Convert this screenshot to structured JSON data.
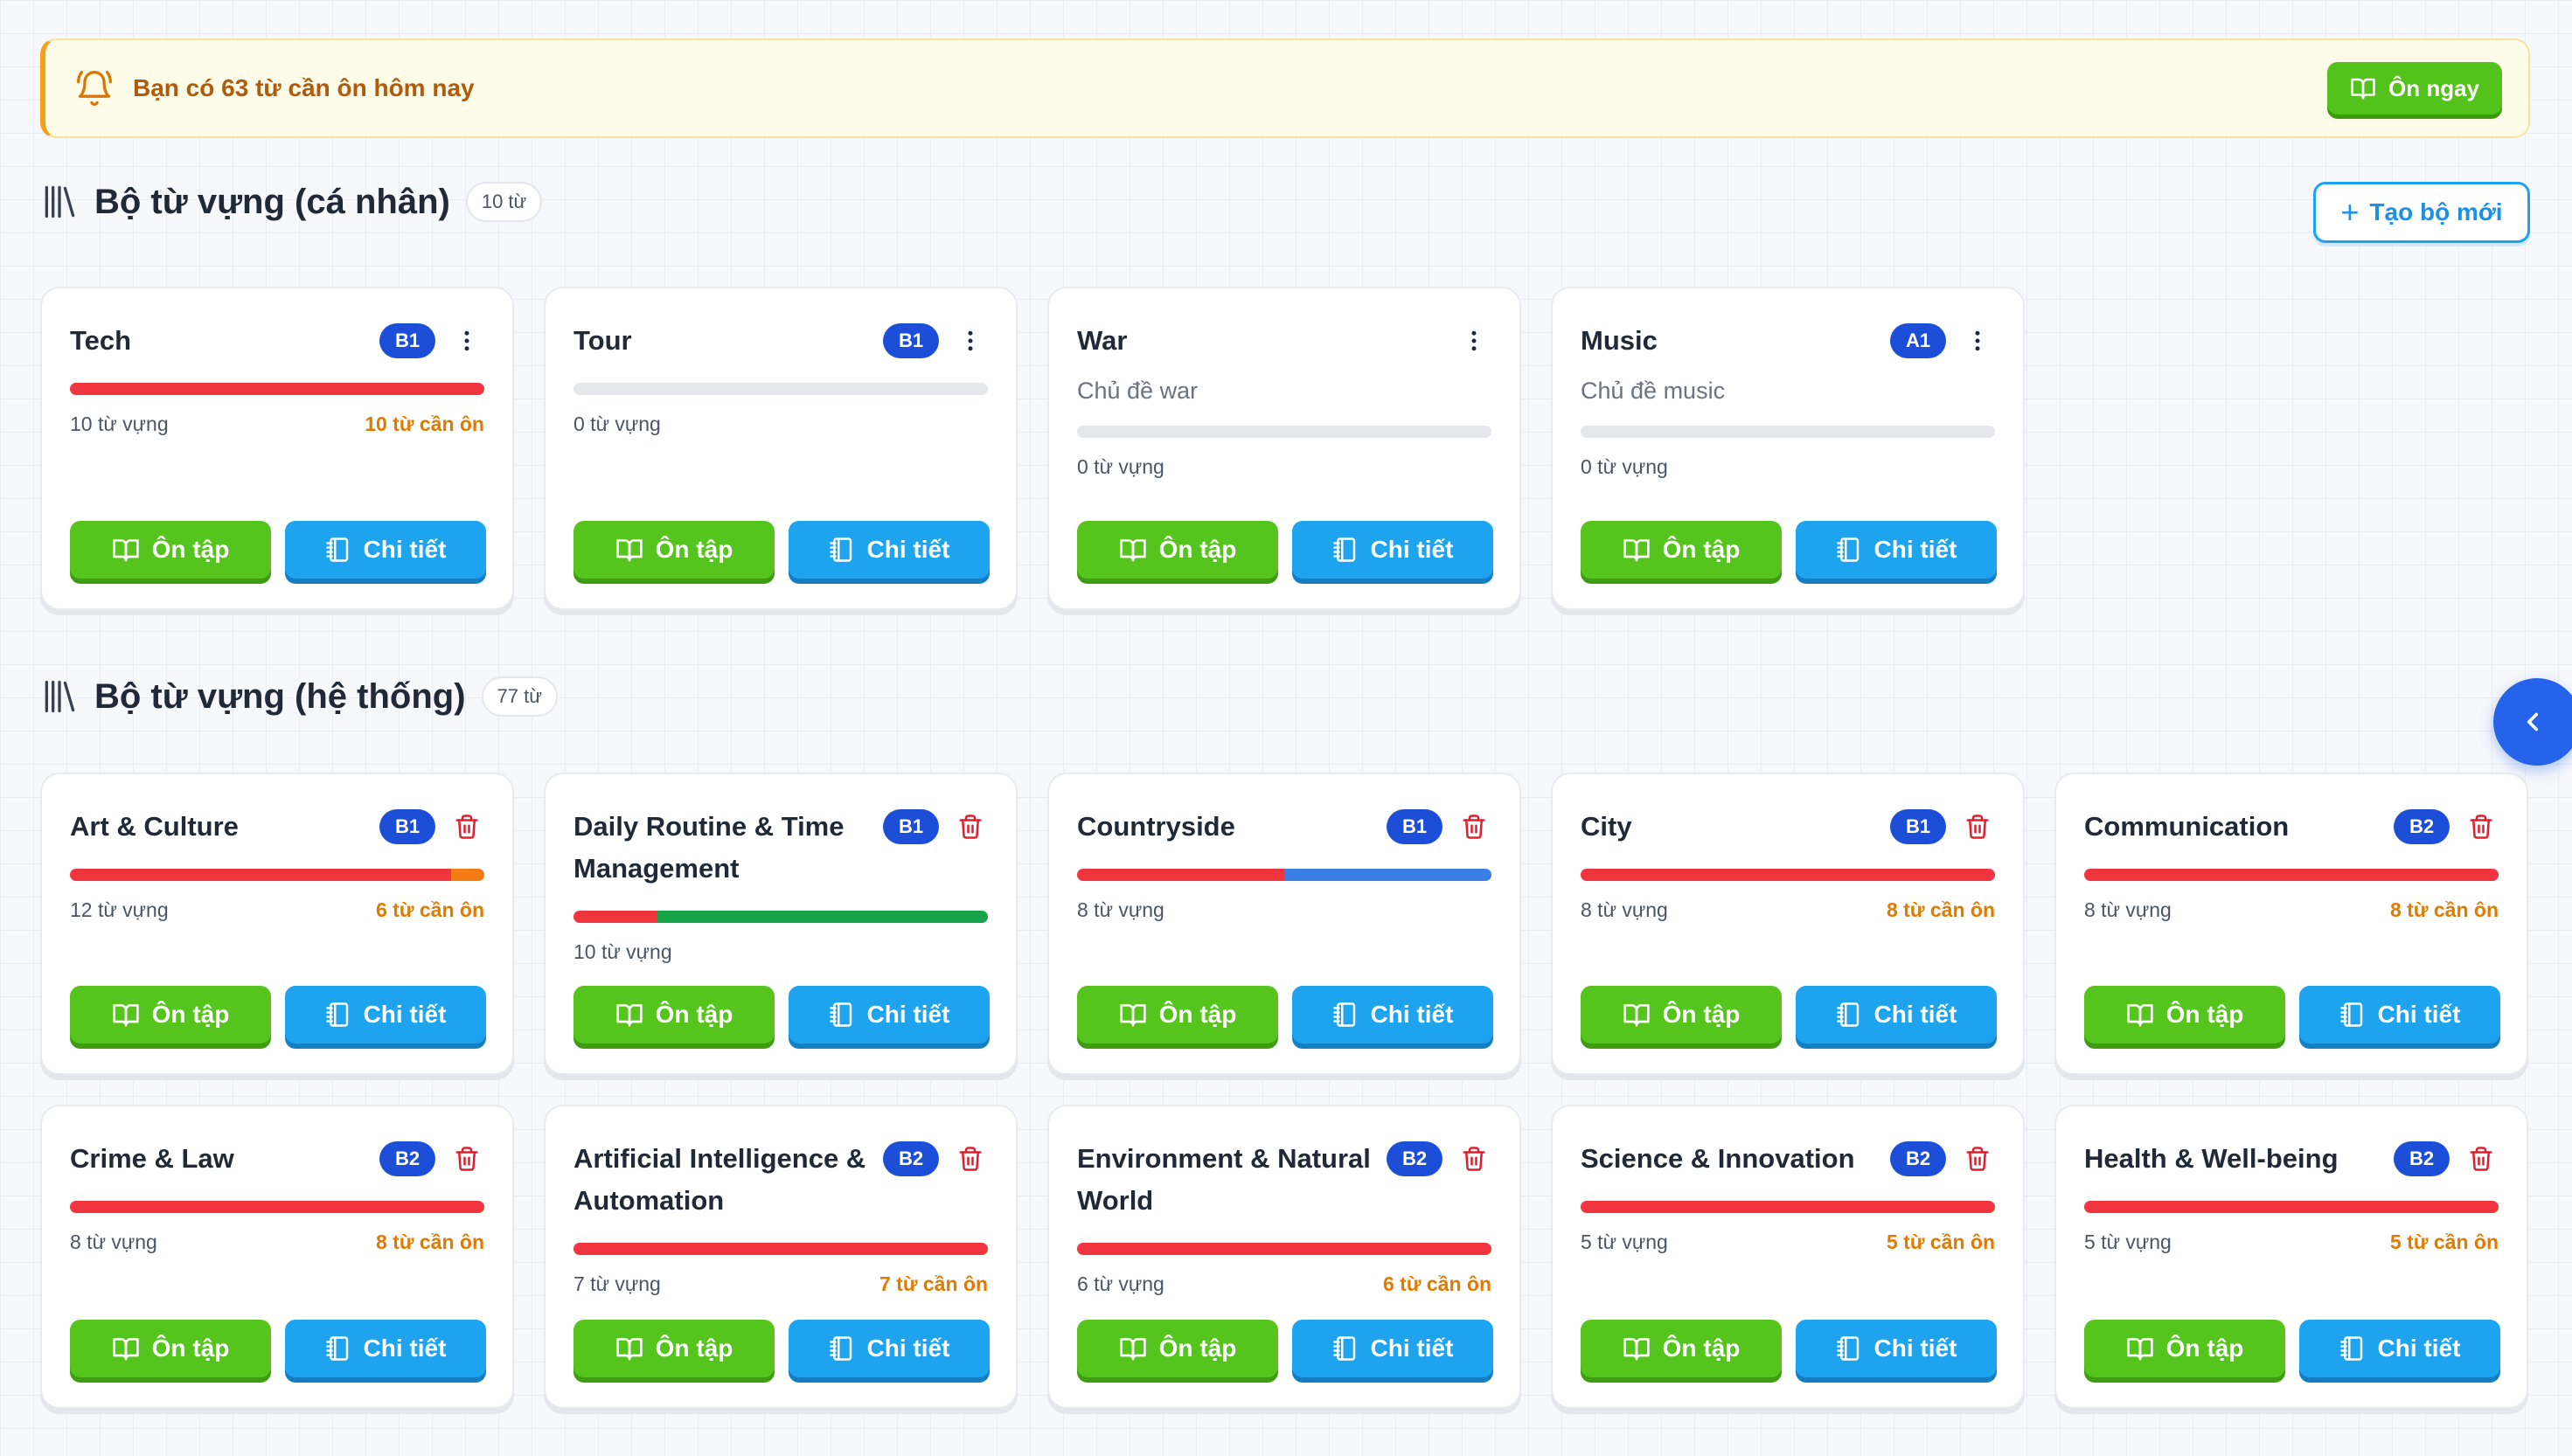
{
  "banner": {
    "prefix": "Bạn có",
    "count": "63",
    "suffix": "từ cần ôn hôm nay",
    "button": "Ôn ngay"
  },
  "personal": {
    "title": "Bộ từ vựng (cá nhân)",
    "count": "10 từ",
    "create_button": "Tạo bộ mới",
    "cards": [
      {
        "name": "Tech",
        "level": "B1",
        "desc": "",
        "words": "10 từ vựng",
        "due": "10 từ cần ôn",
        "progress": [
          {
            "color": "#f0353f",
            "fraction": 1.0
          }
        ]
      },
      {
        "name": "Tour",
        "level": "B1",
        "desc": "",
        "words": "0 từ vựng",
        "due": "",
        "progress": []
      },
      {
        "name": "War",
        "level": "",
        "desc": "Chủ đề war",
        "words": "0 từ vựng",
        "due": "",
        "progress": []
      },
      {
        "name": "Music",
        "level": "A1",
        "desc": "Chủ đề music",
        "words": "0 từ vựng",
        "due": "",
        "progress": []
      }
    ]
  },
  "system": {
    "title": "Bộ từ vựng (hệ thống)",
    "count": "77 từ",
    "cards": [
      {
        "name": "Art & Culture",
        "level": "B1",
        "words": "12 từ vựng",
        "due": "6 từ cần ôn",
        "progress": [
          {
            "color": "#f0353f",
            "fraction": 0.92
          },
          {
            "color": "#f57c12",
            "fraction": 0.08
          }
        ]
      },
      {
        "name": "Daily Routine & Time Management",
        "level": "B1",
        "words": "10 từ vựng",
        "due": "",
        "progress": [
          {
            "color": "#f0353f",
            "fraction": 0.2
          },
          {
            "color": "#16a34a",
            "fraction": 0.8
          }
        ]
      },
      {
        "name": "Countryside",
        "level": "B1",
        "words": "8 từ vựng",
        "due": "",
        "progress": [
          {
            "color": "#f0353f",
            "fraction": 0.5
          },
          {
            "color": "#3b7fe6",
            "fraction": 0.5
          }
        ]
      },
      {
        "name": "City",
        "level": "B1",
        "words": "8 từ vựng",
        "due": "8 từ cần ôn",
        "progress": [
          {
            "color": "#f0353f",
            "fraction": 1.0
          }
        ]
      },
      {
        "name": "Communication",
        "level": "B2",
        "words": "8 từ vựng",
        "due": "8 từ cần ôn",
        "progress": [
          {
            "color": "#f0353f",
            "fraction": 1.0
          }
        ]
      },
      {
        "name": "Crime & Law",
        "level": "B2",
        "words": "8 từ vựng",
        "due": "8 từ cần ôn",
        "progress": [
          {
            "color": "#f0353f",
            "fraction": 1.0
          }
        ]
      },
      {
        "name": "Artificial Intelligence & Automation",
        "level": "B2",
        "words": "7 từ vựng",
        "due": "7 từ cần ôn",
        "progress": [
          {
            "color": "#f0353f",
            "fraction": 1.0
          }
        ]
      },
      {
        "name": "Environment & Natural World",
        "level": "B2",
        "words": "6 từ vựng",
        "due": "6 từ cần ôn",
        "progress": [
          {
            "color": "#f0353f",
            "fraction": 1.0
          }
        ]
      },
      {
        "name": "Science & Innovation",
        "level": "B2",
        "words": "5 từ vựng",
        "due": "5 từ cần ôn",
        "progress": [
          {
            "color": "#f0353f",
            "fraction": 1.0
          }
        ]
      },
      {
        "name": "Health & Well-being",
        "level": "B2",
        "words": "5 từ vựng",
        "due": "5 từ cần ôn",
        "progress": [
          {
            "color": "#f0353f",
            "fraction": 1.0
          }
        ]
      }
    ]
  },
  "labels": {
    "review": "Ôn tập",
    "detail": "Chi tiết"
  },
  "icons": {
    "banner": "bell-icon",
    "section": "library-icon",
    "review": "book-open-icon",
    "detail": "notebook-icon",
    "personal_menu": "more-vertical-icon",
    "system_delete": "trash-icon",
    "toggle": "chevron-left-icon"
  }
}
